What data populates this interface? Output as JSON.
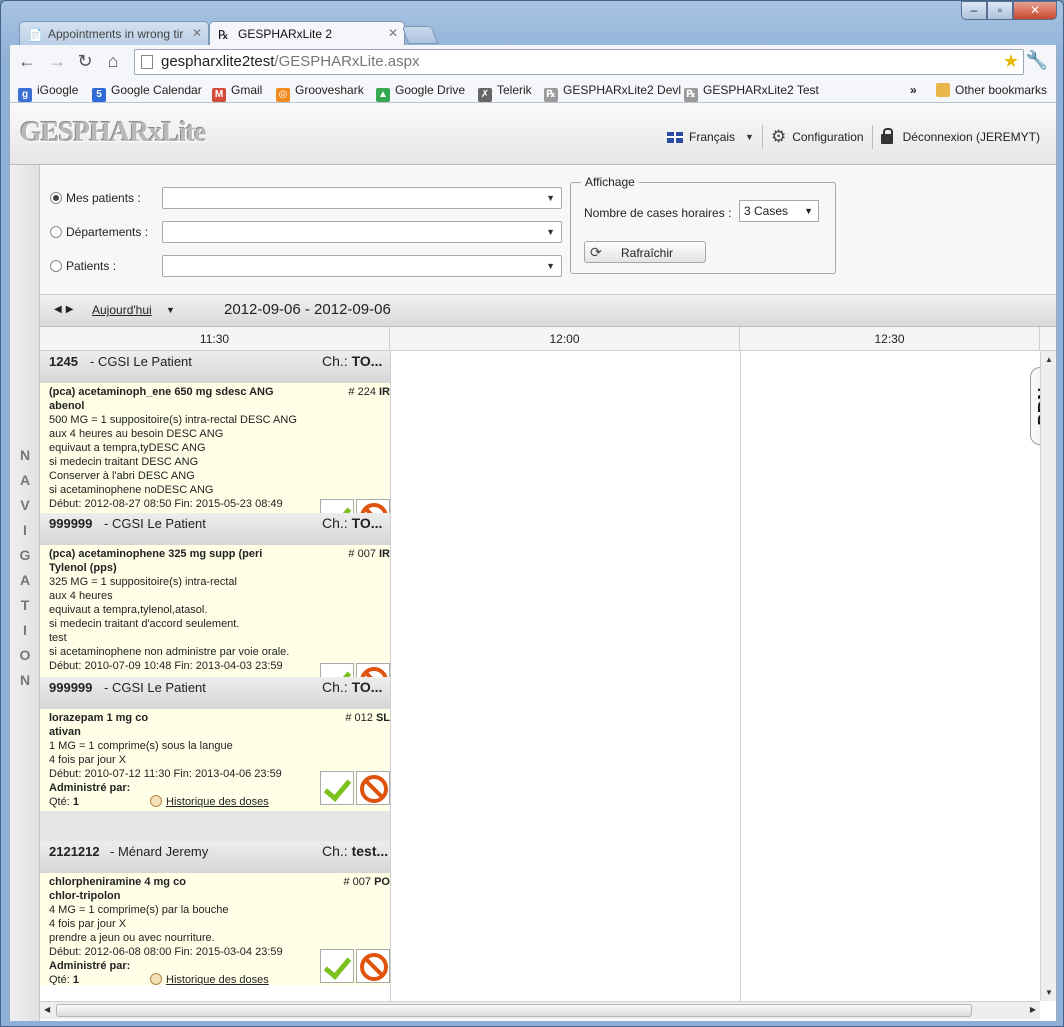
{
  "browser": {
    "tabs": [
      {
        "label": "Appointments in wrong tir"
      },
      {
        "label": "GESPHARxLite 2"
      }
    ],
    "url_host": "gespharxlite2test",
    "url_path": "/GESPHARxLite.aspx",
    "bookmarks": [
      {
        "label": "iGoogle",
        "icon_color": "#3b6fd6",
        "icon_text": "g"
      },
      {
        "label": "Google Calendar",
        "icon_color": "#2f6ad6",
        "icon_text": "5"
      },
      {
        "label": "Gmail",
        "icon_color": "#d44b3a",
        "icon_text": "M"
      },
      {
        "label": "Grooveshark",
        "icon_color": "#f08a1c",
        "icon_text": "◎"
      },
      {
        "label": "Google Drive",
        "icon_color": "#36a852",
        "icon_text": "▲"
      },
      {
        "label": "Telerik",
        "icon_color": "#666666",
        "icon_text": "✗"
      },
      {
        "label": "GESPHARxLite2 Devl",
        "icon_color": "#9a9a9a",
        "icon_text": "℞"
      },
      {
        "label": "GESPHARxLite2 Test",
        "icon_color": "#9a9a9a",
        "icon_text": "℞"
      }
    ],
    "overflow": "»",
    "other_bookmarks": "Other bookmarks"
  },
  "header": {
    "logo": "GESPHARxLite",
    "language": "Français",
    "config": "Configuration",
    "logout": "Déconnexion (JEREMYT)"
  },
  "nav": {
    "label": "NAVIGATION"
  },
  "filter": {
    "rows": [
      {
        "label": "Mes patients :",
        "selected": true
      },
      {
        "label": "Départements :",
        "selected": false
      },
      {
        "label": "Patients :",
        "selected": false
      }
    ],
    "affichage": {
      "legend": "Affichage",
      "slots_label": "Nombre de cases horaires :",
      "slots_value": "3 Cases",
      "refresh": "Rafraîchir"
    }
  },
  "schedule": {
    "today": "Aujourd'hui",
    "range": "2012-09-06 - 2012-09-06",
    "times": [
      "11:30",
      "12:00",
      "12:30"
    ]
  },
  "patients": [
    {
      "id": "1245",
      "name": "CGSI Le Patient",
      "ch_label": "Ch.:",
      "ch_value": "TO...",
      "rx_prefix": "# 224",
      "rx_route": "IR",
      "lines": [
        "(pca) acetaminoph_ene 650 mg sdesc ANG",
        "abenol",
        "500 MG = 1 suppositoire(s) intra-rectal DESC ANG",
        "aux 4 heures au besoin DESC ANG",
        "equivaut a tempra,tyDESC ANG",
        "si medecin traitant DESC ANG",
        "Conserver à l'abri DESC ANG",
        "si acetaminophene noDESC ANG",
        "Début: 2012-08-27 08:50 Fin: 2015-05-23 08:49"
      ]
    },
    {
      "id": "999999",
      "name": "CGSI Le Patient",
      "ch_label": "Ch.:",
      "ch_value": "TO...",
      "rx_prefix": "# 007",
      "rx_route": "IR",
      "lines": [
        "(pca) acetaminophene 325 mg supp (peri",
        "Tylenol (pps)",
        "325 MG = 1 suppositoire(s) intra-rectal",
        "aux 4 heures",
        "equivaut a tempra,tylenol,atasol.",
        "si medecin traitant d'accord seulement.",
        "test",
        "si acetaminophene non administre par voie orale.",
        "Début: 2010-07-09 10:48 Fin: 2013-04-03 23:59"
      ]
    },
    {
      "id": "999999",
      "name": "CGSI Le Patient",
      "ch_label": "Ch.:",
      "ch_value": "TO...",
      "rx_prefix": "# 012",
      "rx_route": "SL",
      "lines": [
        "lorazepam 1 mg co",
        "ativan",
        "1 MG = 1 comprime(s) sous la langue",
        "4 fois par jour X",
        "Début: 2010-07-12 11:30 Fin: 2013-04-06 23:59"
      ],
      "admin_label": "Administré par:",
      "qty_label": "Qté:",
      "qty_value": "1",
      "history": "Historique des doses"
    },
    {
      "id": "2121212",
      "name": "Ménard Jeremy",
      "ch_label": "Ch.:",
      "ch_value": "test...",
      "rx_prefix": "# 007",
      "rx_route": "PO",
      "lines": [
        "chlorpheniramine 4 mg co",
        "chlor-tripolon",
        "4 MG = 1 comprime(s) par la bouche",
        "4 fois par jour X",
        "prendre a jeun ou avec nourriture.",
        "Début: 2012-06-08 08:00 Fin: 2015-03-04 23:59"
      ],
      "admin_label": "Administré par:",
      "qty_label": "Qté:",
      "qty_value": "1",
      "history": "Historique des doses"
    }
  ],
  "prn": "PRN"
}
